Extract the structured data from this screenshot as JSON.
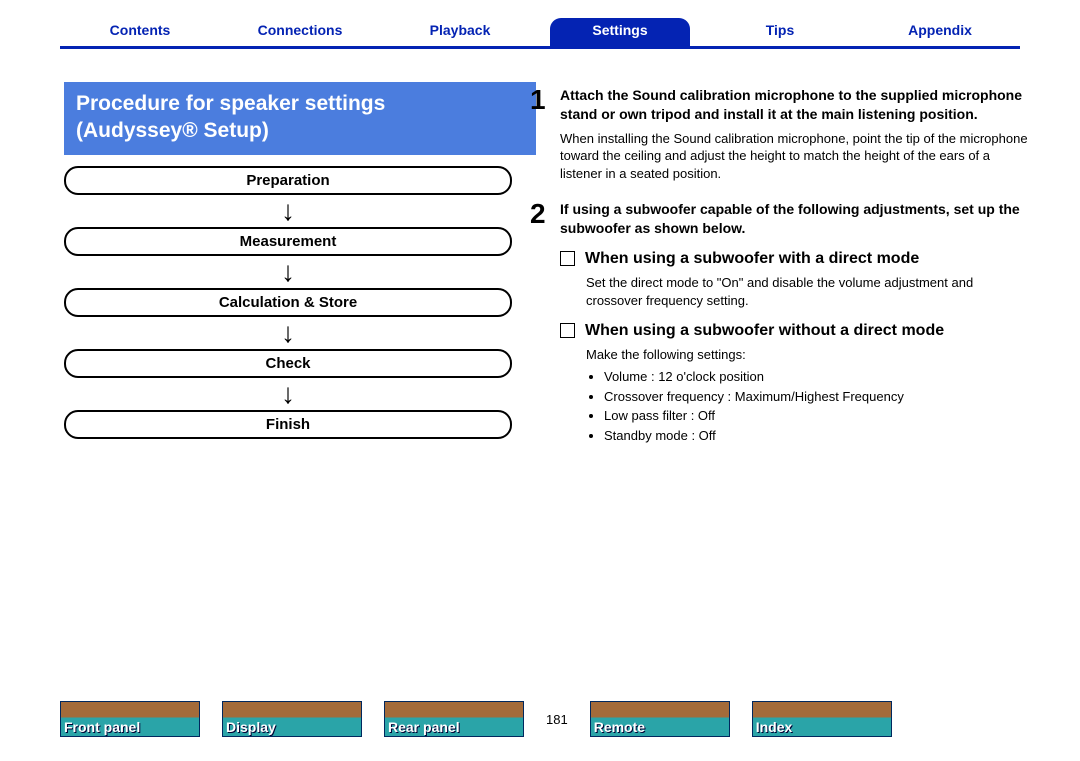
{
  "nav": {
    "tabs": [
      "Contents",
      "Connections",
      "Playback",
      "Settings",
      "Tips",
      "Appendix"
    ],
    "active_index": 3
  },
  "heading": {
    "line1": "Procedure for speaker settings",
    "line2": "(Audyssey® Setup)"
  },
  "flow_stages": [
    "Preparation",
    "Measurement",
    "Calculation & Store",
    "Check",
    "Finish"
  ],
  "steps": [
    {
      "num": "1",
      "bold": "Attach the Sound calibration microphone to the supplied microphone stand or own tripod and install it at the main listening position.",
      "detail": "When installing the Sound calibration microphone, point the tip of the microphone toward the ceiling and adjust the height to match the height of the ears of a listener in a seated position."
    },
    {
      "num": "2",
      "bold": "If using a subwoofer capable of the following adjustments, set up the subwoofer as shown below."
    }
  ],
  "sub1": {
    "title": "When using a subwoofer with a direct mode",
    "detail": "Set the direct mode to \"On\" and disable the volume adjustment and crossover frequency setting."
  },
  "sub2": {
    "title": "When using a subwoofer without a direct mode",
    "intro": "Make the following settings:",
    "items": [
      "Volume : 12 o'clock position",
      "Crossover frequency : Maximum/Highest Frequency",
      "Low pass filter : Off",
      "Standby mode : Off"
    ]
  },
  "footer": {
    "items": [
      "Front panel",
      "Display",
      "Rear panel",
      "Remote",
      "Index"
    ],
    "page_num": "181"
  }
}
